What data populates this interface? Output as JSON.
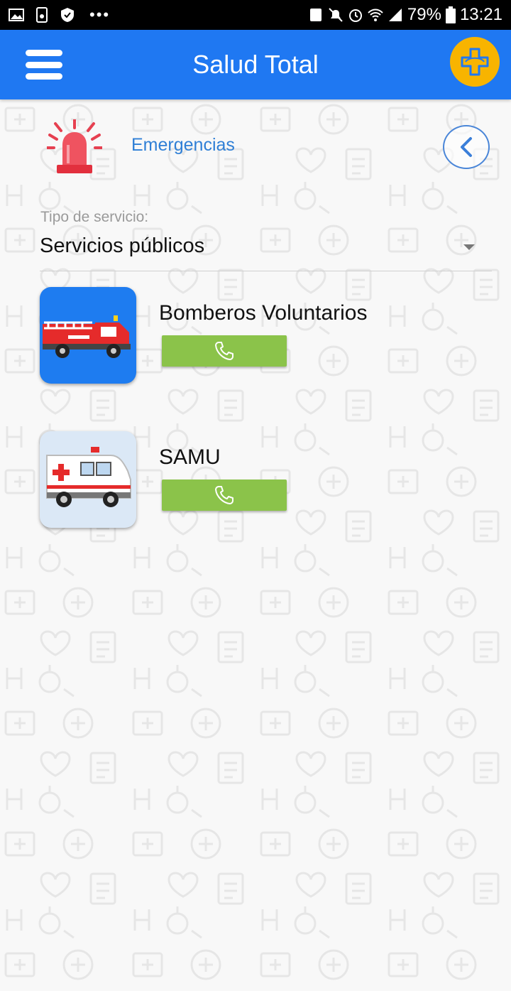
{
  "status_bar": {
    "battery": "79%",
    "time": "13:21",
    "dots": "•••"
  },
  "app_bar": {
    "title": "Salud Total"
  },
  "section": {
    "title": "Emergencias"
  },
  "filter": {
    "label": "Tipo de servicio:",
    "selected": "Servicios públicos"
  },
  "services": [
    {
      "name": "Bomberos Voluntarios",
      "icon": "fire-truck-icon"
    },
    {
      "name": "SAMU",
      "icon": "ambulance-icon"
    }
  ],
  "colors": {
    "app_bar": "#1f78f2",
    "logo": "#f8b400",
    "call_button": "#8bc34a",
    "accent_text": "#2f7fd6"
  }
}
